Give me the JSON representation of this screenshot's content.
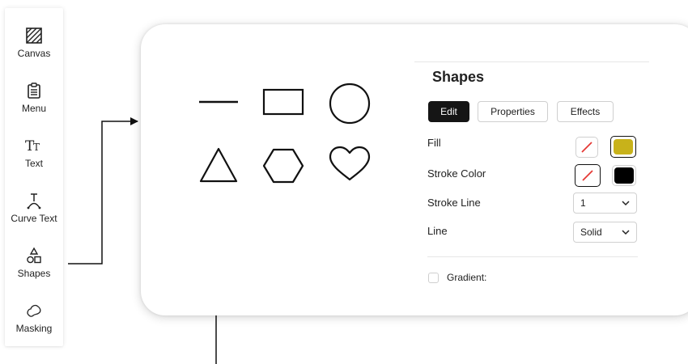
{
  "toolbar": {
    "items": [
      {
        "label": "Canvas",
        "icon": "canvas-icon"
      },
      {
        "label": "Menu",
        "icon": "menu-clipboard-icon"
      },
      {
        "label": "Text",
        "icon": "text-icon"
      },
      {
        "label": "Curve Text",
        "icon": "curve-text-icon"
      },
      {
        "label": "Shapes",
        "icon": "shapes-icon"
      },
      {
        "label": "Masking",
        "icon": "masking-icon"
      }
    ]
  },
  "shapes": [
    "line",
    "rectangle",
    "circle",
    "triangle",
    "hexagon",
    "heart"
  ],
  "properties": {
    "title": "Shapes",
    "tabs": [
      {
        "label": "Edit",
        "active": true
      },
      {
        "label": "Properties",
        "active": false
      },
      {
        "label": "Effects",
        "active": false
      }
    ],
    "fill": {
      "label": "Fill",
      "options": [
        "none",
        "#c8b21a"
      ],
      "selected": "#c8b21a"
    },
    "stroke_color": {
      "label": "Stroke Color",
      "options": [
        "none",
        "#000000"
      ],
      "selected": "none"
    },
    "stroke_line": {
      "label": "Stroke Line",
      "value": "1"
    },
    "line": {
      "label": "Line",
      "value": "Solid"
    },
    "gradient": {
      "label": "Gradient:",
      "checked": false
    }
  },
  "colors": {
    "accent_dark": "#151515",
    "no_color_slash": "#e53935",
    "fill_gold": "#c8b21a"
  }
}
